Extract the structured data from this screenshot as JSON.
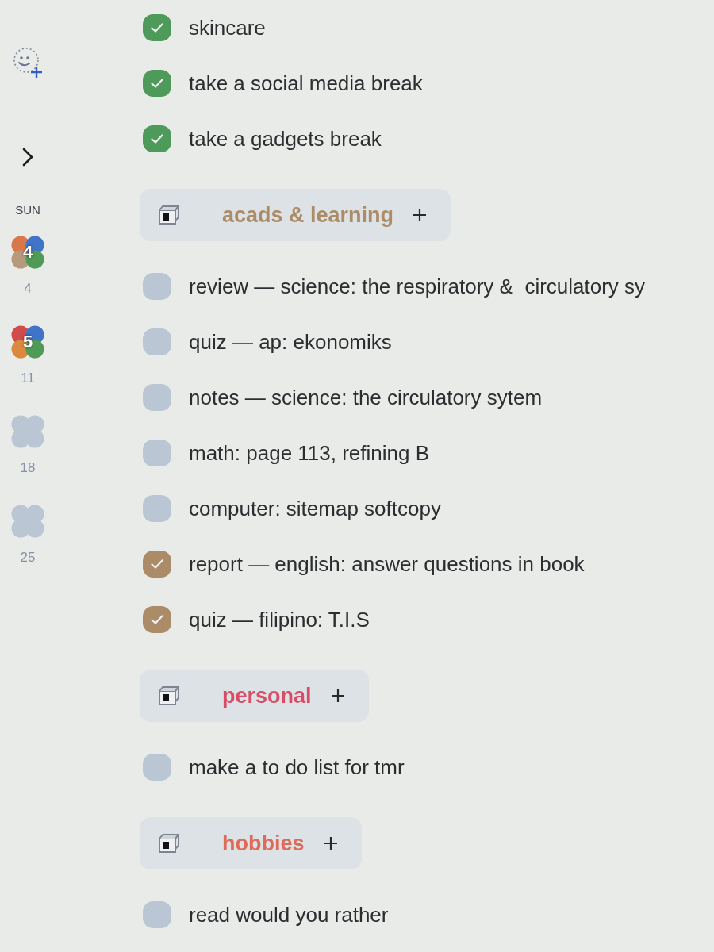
{
  "sidebar": {
    "weekday": "SUN",
    "weeks": [
      {
        "count": "4",
        "date": "4",
        "petals": [
          {
            "color": "#d9774a"
          },
          {
            "color": "#3f74c8"
          },
          {
            "color": "#b79a7c"
          },
          {
            "color": "#4f9a54"
          }
        ]
      },
      {
        "count": "5",
        "date": "11",
        "petals": [
          {
            "color": "#d14b4b"
          },
          {
            "color": "#3f74c8"
          },
          {
            "color": "#d98a3e"
          },
          {
            "color": "#4f9a54"
          }
        ]
      },
      {
        "date": "18"
      },
      {
        "date": "25"
      }
    ]
  },
  "lists": [
    {
      "color": "#4e9a5a",
      "tasks": [
        {
          "text": "skincare",
          "checked": true
        },
        {
          "text": "take a social media break",
          "checked": true
        },
        {
          "text": "take a gadgets break",
          "checked": true
        }
      ]
    },
    {
      "title": "acads & learning",
      "color": "#ac8c68",
      "tasks": [
        {
          "text": "review — science: the respiratory &  circulatory sy",
          "checked": false
        },
        {
          "text": "quiz — ap: ekonomiks",
          "checked": false
        },
        {
          "text": "notes — science: the circulatory sytem",
          "checked": false
        },
        {
          "text": "math: page 113, refining B",
          "checked": false
        },
        {
          "text": "computer: sitemap softcopy",
          "checked": false
        },
        {
          "text": "report — english: answer questions in book",
          "checked": true
        },
        {
          "text": "quiz — filipino: T.I.S",
          "checked": true
        }
      ]
    },
    {
      "title": "personal",
      "color": "#d84c66",
      "tasks": [
        {
          "text": "make a to do list for tmr",
          "checked": false
        }
      ]
    },
    {
      "title": "hobbies",
      "color": "#e06a58",
      "tasks": [
        {
          "text": "read would you rather",
          "checked": false
        }
      ]
    }
  ]
}
